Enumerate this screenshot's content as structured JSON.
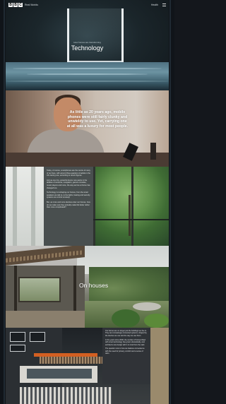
{
  "header": {
    "logo_letters": [
      "B",
      "B",
      "C"
    ],
    "site_name": "Real Worlds",
    "nav_link": "Health",
    "menu_icon": "menu-grid-icon"
  },
  "hero": {
    "kicker": "How homes are transforming",
    "title": "Technology"
  },
  "quote": {
    "text": "As little as 20 years ago, mobile phones were still fairly clunky and unwieldy to use. Yet, carrying one at all was a luxury for most people."
  },
  "article": {
    "paragraphs": [
      "Today, of course, smartphones are the centre of many of our lives, with around three-quarters of adults in the UK owning one, according to recent figures.",
      "And as one tiny, powerful device now packs in the abilities of cameras, navigation, games consoles, music players and more, the way we live at home has changed too.",
      "Technology is reshaping our homes, from the smart speakers we talk to, to the lights, heating and security systems we control remotely.",
      "But, as more and more devices enter our homes, how do we make sure they actually make life better rather than more complicated?"
    ]
  },
  "houses": {
    "title": "On houses"
  },
  "bottom": {
    "paragraphs": [
      "Our homes are no longer just the buildings we live in. They are increasingly connected systems, shaped by the devices we use and the way we use them.",
      "In the years since 2000, the number of homes fitted with smart technology has grown dramatically, and architects now design with it in mind from the start.",
      "The question now is how we balance convenience with the need for privacy, comfort and a sense of calm."
    ]
  }
}
